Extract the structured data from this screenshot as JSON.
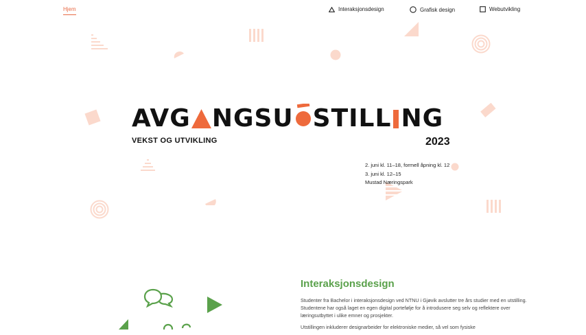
{
  "nav": {
    "home": "Hjem",
    "items": [
      {
        "label": "Interaksjonsdesign",
        "icon": "triangle-outline-icon"
      },
      {
        "label": "Grafisk design",
        "icon": "circle-outline-icon"
      },
      {
        "label": "Webutvikling",
        "icon": "square-outline-icon"
      }
    ]
  },
  "hero": {
    "title_part1": "AVG",
    "title_part2": "NGSU",
    "title_part3": "STILL",
    "title_part4": "NG",
    "subtitle": "VEKST OG UTVIKLING",
    "year": "2023",
    "info": [
      "2. juni kl. 11–18, formell åpning kl. 12",
      "3. juni kl. 12–15",
      "Mustad Næringspark"
    ]
  },
  "section": {
    "title": "Interaksjonsdesign",
    "paragraphs": [
      "Studenter fra Bachelor i interaksjonsdesign ved NTNU i Gjøvik avslutter tre års studier med en utstilling. Studentene har også laget en egen digital portefølje for å introdusere seg selv og reflektere over læringsutbyttet i ulike emner og prosjekter.",
      "Utstillingen inkluderer designarbeider for elektroniske medier, så vel som fysiske"
    ]
  },
  "colors": {
    "accent": "#ee6a3c",
    "decor": "#fbd9cc",
    "green": "#5aa14b"
  }
}
